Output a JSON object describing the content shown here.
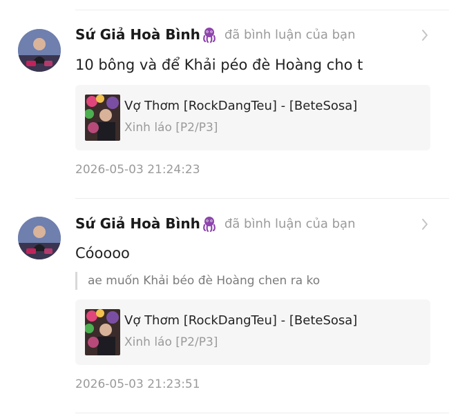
{
  "notifications": [
    {
      "username": "Sứ Giả Hoà Bình",
      "badge_icon": "purple-octopus-emoji",
      "action_text": "đã bình luận của bạn",
      "comment": "10 bông và để Khải péo đè Hoàng cho t",
      "quoted_comment": "",
      "card": {
        "title": "Vợ Thơm [RockDangTeu] - [BeteSosa]",
        "subtitle": "Xinh láo [P2/P3]"
      },
      "timestamp": "2026-05-03 21:24:23"
    },
    {
      "username": "Sứ Giả Hoà Bình",
      "badge_icon": "purple-octopus-emoji",
      "action_text": "đã bình luận của bạn",
      "comment": "Cóoooo",
      "quoted_comment": "ae muốn Khải béo đè Hoàng chen ra ko",
      "card": {
        "title": "Vợ Thơm [RockDangTeu] - [BeteSosa]",
        "subtitle": "Xinh láo [P2/P3]"
      },
      "timestamp": "2026-05-03 21:23:51"
    }
  ],
  "colors": {
    "username": "#1a1a1a",
    "meta_gray": "#9a9a9a",
    "card_bg": "#f6f6f6",
    "divider": "#ececec",
    "badge_purple": "#8e44ad"
  }
}
